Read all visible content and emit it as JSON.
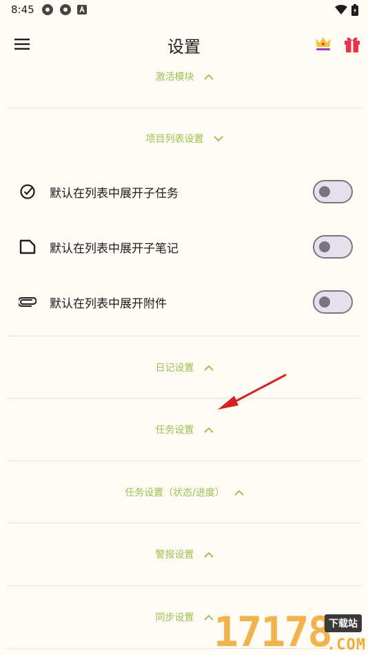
{
  "status": {
    "time": "8:45"
  },
  "header": {
    "title": "设置"
  },
  "sections": {
    "activation": "激活模块",
    "list_settings": "项目列表设置",
    "journal": "日记设置",
    "task": "任务设置",
    "task_status": "任务设置（状态/进度）",
    "alarm": "警报设置",
    "sync": "同步设置"
  },
  "toggles": [
    {
      "label": "默认在列表中展开子任务",
      "on": false
    },
    {
      "label": "默认在列表中展开子笔记",
      "on": false
    },
    {
      "label": "默认在列表中展开附件",
      "on": false
    }
  ],
  "colors": {
    "accent": "#9fc055",
    "background": "#fdfbf3",
    "annotation_arrow": "#d42222"
  },
  "watermark": {
    "digits": "17178",
    "tag": "下载站",
    "suffix": ".COM"
  }
}
